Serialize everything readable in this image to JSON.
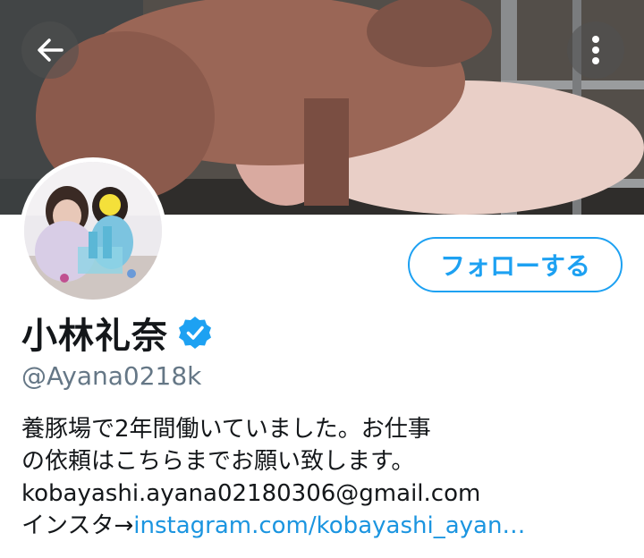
{
  "header": {
    "back_icon": "back-arrow-icon",
    "more_icon": "vertical-ellipsis-icon"
  },
  "profile": {
    "display_name": "小林礼奈",
    "verified": true,
    "handle": "@Ayana0218k",
    "follow_label": "フォローする",
    "bio": {
      "line1": "養豚場で2年間働いていました。お仕事",
      "line2": "の依頼はこちらまでお願い致します。",
      "line3": "kobayashi.ayana02180306@gmail.com",
      "line4_prefix": "インスタ→",
      "line4_link": "instagram.com/kobayashi_ayan…"
    }
  },
  "colors": {
    "accent": "#1da1f2",
    "link": "#1b95e0",
    "text": "#14171a",
    "secondary": "#657786"
  }
}
